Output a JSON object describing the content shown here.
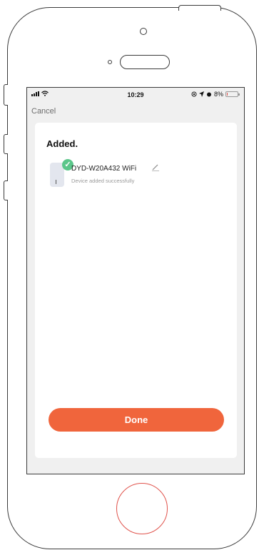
{
  "status_bar": {
    "time": "10:29",
    "battery_text": "8%",
    "battery_level": 0.08
  },
  "nav": {
    "cancel_label": "Cancel"
  },
  "card": {
    "title": "Added.",
    "device": {
      "name": "DYD-W20A432 WiFi",
      "status": "Device added successfully",
      "check_icon": "checkmark-icon",
      "edit_icon": "pencil-icon"
    }
  },
  "actions": {
    "done_label": "Done"
  },
  "colors": {
    "accent": "#f0653c",
    "success": "#5bc68a",
    "home_button": "#e0524b"
  }
}
